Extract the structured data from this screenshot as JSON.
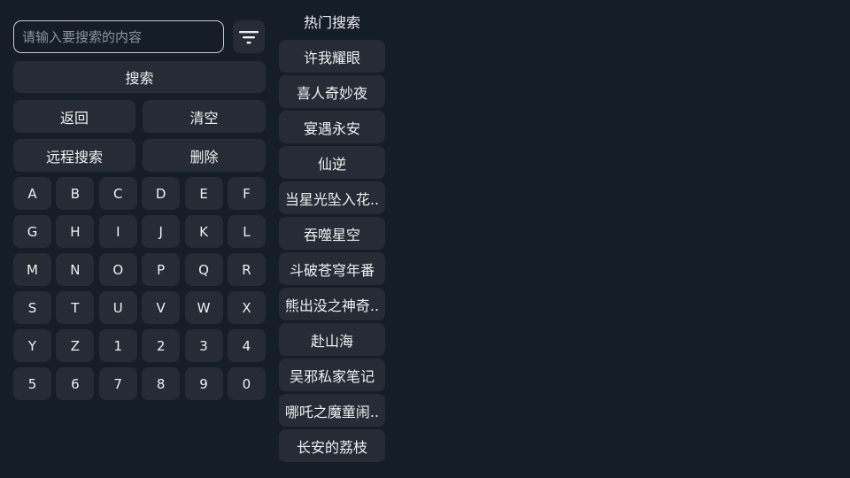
{
  "search": {
    "value": "",
    "placeholder": "请输入要搜索的内容"
  },
  "icons": {
    "filter": "filter-icon"
  },
  "actions": {
    "search": "搜索",
    "back": "返回",
    "clear": "清空",
    "remote_search": "远程搜索",
    "delete": "删除"
  },
  "keyboard": {
    "keys": [
      "A",
      "B",
      "C",
      "D",
      "E",
      "F",
      "G",
      "H",
      "I",
      "J",
      "K",
      "L",
      "M",
      "N",
      "O",
      "P",
      "Q",
      "R",
      "S",
      "T",
      "U",
      "V",
      "W",
      "X",
      "Y",
      "Z",
      "1",
      "2",
      "3",
      "4",
      "5",
      "6",
      "7",
      "8",
      "9",
      "0"
    ]
  },
  "hot": {
    "title": "热门搜索",
    "items": [
      "许我耀眼",
      "喜人奇妙夜",
      "宴遇永安",
      "仙逆",
      "当星光坠入花..",
      "吞噬星空",
      "斗破苍穹年番",
      "熊出没之神奇..",
      "赴山海",
      "吴邪私家笔记",
      "哪吒之魔童闹..",
      "长安的荔枝"
    ]
  },
  "colors": {
    "background": "#141d28",
    "button": "#262c35",
    "text": "#eef0f2",
    "input_border": "#c9ccd0"
  }
}
